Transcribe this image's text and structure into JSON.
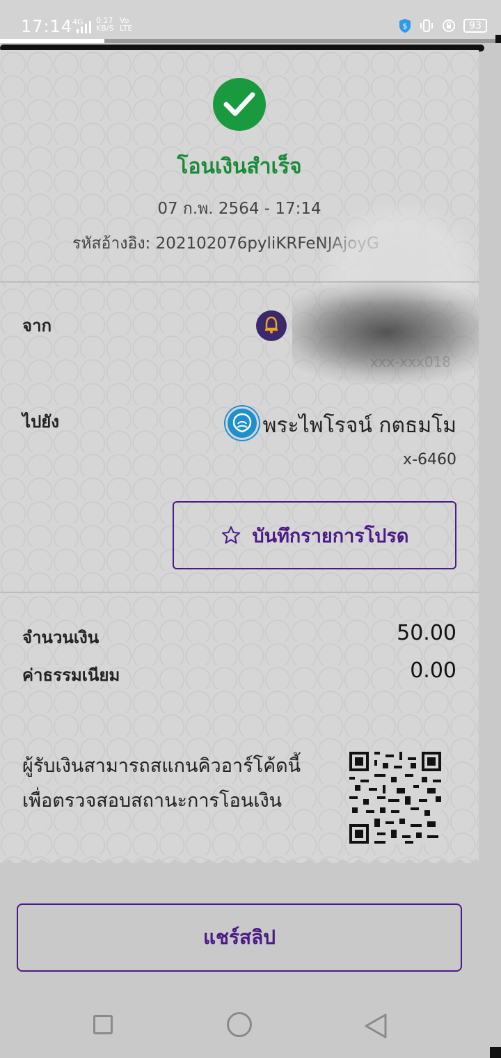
{
  "status_bar": {
    "time": "17:14",
    "network": "4G",
    "speed": "0.17\nKB/S",
    "volte": "Vo\nLTE",
    "battery": "93"
  },
  "receipt": {
    "title": "โอนเงินสำเร็จ",
    "datetime": "07 ก.พ. 2564 - 17:14",
    "ref_label": "รหัสอ้างอิง:",
    "ref_value": "202102076pyliKRFeNJAjoyG",
    "from_label": "จาก",
    "from_account": "xxx-xxx018",
    "to_label": "ไปยัง",
    "to_name": "พระไพโรจน์ กตธมโม",
    "to_account": "x-6460",
    "favorite_button": "บันทึกรายการโปรด",
    "amount_label": "จำนวนเงิน",
    "amount_value": "50.00",
    "fee_label": "ค่าธรรมเนียม",
    "fee_value": "0.00",
    "qr_text_line1": "ผู้รับเงินสามารถสแกนคิวอาร์โค้ดนี้",
    "qr_text_line2": "เพื่อตรวจสอบสถานะการโอนเงิน"
  },
  "share_button": "แชร์สลิป",
  "colors": {
    "success_green": "#1a9a3e",
    "brand_purple": "#4b1a85"
  },
  "icons": {
    "success": "check-circle-icon",
    "favorite": "star-icon",
    "from_bank": "bank-logo-icon",
    "to_bank": "bank-logo-icon",
    "nav": [
      "recent-apps-icon",
      "home-icon",
      "back-icon"
    ]
  }
}
